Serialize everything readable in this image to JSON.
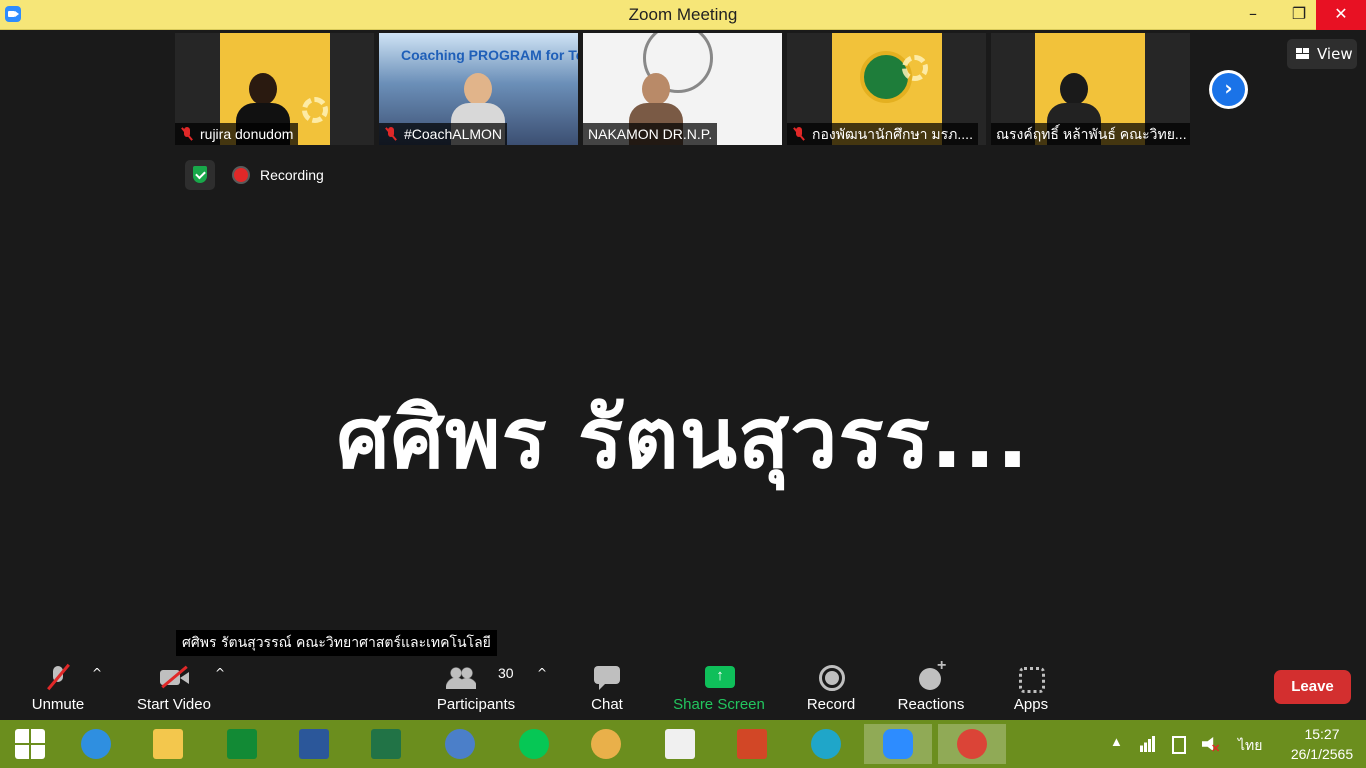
{
  "window": {
    "title": "Zoom Meeting",
    "minimize": "–",
    "maximize": "❐",
    "close": "✕"
  },
  "gallery": {
    "tiles": [
      {
        "name": "rujira donudom",
        "muted": true
      },
      {
        "name": "#CoachALMON",
        "muted": true,
        "poster_text": "Coaching PROGRAM for Teacher"
      },
      {
        "name": "NAKAMON DR.N.P.",
        "muted": false
      },
      {
        "name": "กองพัฒนานักศึกษา มรภ....",
        "muted": true
      },
      {
        "name": "ณรงค์ฤทธิ์ หล้าพันธ์ คณะวิทย...",
        "muted": false
      }
    ],
    "next_arrow": "›",
    "view_label": "View"
  },
  "status": {
    "recording_label": "Recording"
  },
  "main": {
    "active_speaker_display": "ศศิพร รัตนสุวรร...",
    "active_speaker_label": "ศศิพร รัตนสุวรรณ์ คณะวิทยาศาสตร์และเทคโนโลยี"
  },
  "controls": {
    "unmute": "Unmute",
    "start_video": "Start Video",
    "participants": "Participants",
    "participant_count": "30",
    "chat": "Chat",
    "share_screen": "Share Screen",
    "record": "Record",
    "reactions": "Reactions",
    "apps": "Apps",
    "leave": "Leave",
    "caret": "^"
  },
  "taskbar": {
    "apps": [
      "start-icon",
      "internet-explorer-icon",
      "file-explorer-icon",
      "store-icon",
      "word-icon",
      "excel-icon",
      "math-input-icon",
      "line-icon",
      "paint-icon",
      "lisrel-icon",
      "powerpoint-icon",
      "edge-icon",
      "zoom-icon",
      "chrome-icon"
    ],
    "tray": {
      "language": "ไทย",
      "time": "15:27",
      "date": "26/1/2565"
    }
  },
  "colors": {
    "titlebar": "#f6e678",
    "background": "#1a1a1a",
    "share_green": "#22c55e",
    "leave_red": "#d32f2f",
    "taskbar": "#6b8e1e",
    "accent_blue": "#1a73e8"
  }
}
